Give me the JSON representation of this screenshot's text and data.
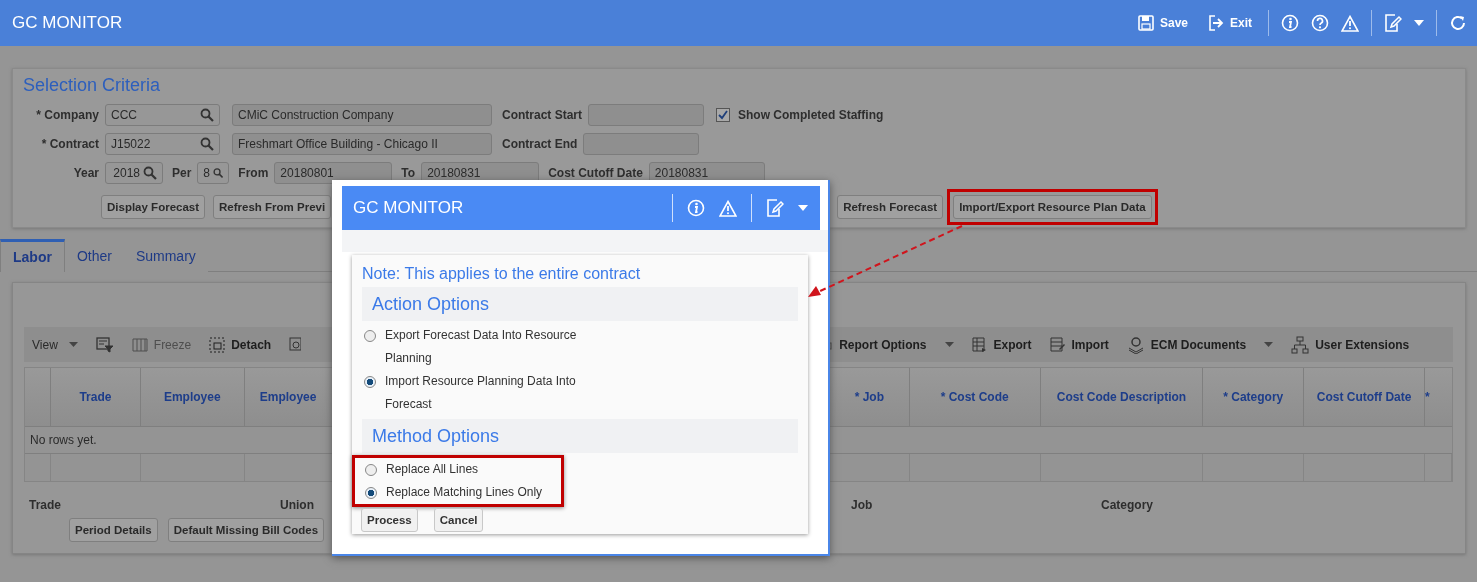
{
  "app_bar": {
    "title": "GC MONITOR",
    "actions": [
      {
        "label": "Save"
      },
      {
        "label": "Exit"
      }
    ]
  },
  "selection_criteria": {
    "title": "Selection Criteria",
    "company": {
      "label": "* Company",
      "value": "CCC",
      "description": "CMiC Construction Company"
    },
    "contract": {
      "label": "* Contract",
      "value": "J15022",
      "description": "Freshmart Office Building - Chicago II"
    },
    "contract_start": {
      "label": "Contract Start"
    },
    "contract_end": {
      "label": "Contract End"
    },
    "show_completed": {
      "label": "Show Completed Staffing",
      "checked": true
    },
    "year": {
      "label": "Year",
      "value": "2018"
    },
    "per": {
      "label": "Per",
      "value": "8"
    },
    "from": {
      "label": "From",
      "value": "20180801"
    },
    "to": {
      "label": "To",
      "value": "20180831"
    },
    "cost_cutoff": {
      "label": "Cost Cutoff Date",
      "value": "20180831"
    },
    "buttons_left": [
      "Display Forecast",
      "Refresh From Previ"
    ],
    "buttons_right": [
      {
        "label": "Refresh Forecast",
        "highlighted": false
      },
      {
        "label": "Import/Export Resource Plan Data",
        "highlighted": true
      }
    ]
  },
  "tabs": [
    {
      "label": "Labor",
      "selected": true
    },
    {
      "label": "Other",
      "selected": false
    },
    {
      "label": "Summary",
      "selected": false
    }
  ],
  "toolbar": {
    "left": [
      {
        "label": "View"
      },
      {
        "label": "Freeze",
        "disabled": true
      },
      {
        "label": "Detach",
        "disabled": false
      }
    ],
    "right": [
      {
        "label": "Report Options"
      },
      {
        "label": "Export"
      },
      {
        "label": "Import"
      },
      {
        "label": "ECM Documents"
      },
      {
        "label": "User Extensions"
      }
    ]
  },
  "table": {
    "columns_left": [
      "Trade",
      "Employee",
      "Employee"
    ],
    "columns_right": [
      "* Job",
      "* Cost Code",
      "Cost Code Description",
      "* Category",
      "Cost Cutoff Date",
      "*"
    ],
    "empty_message": "No rows yet."
  },
  "footer": {
    "labels_left": [
      "Trade",
      "Union"
    ],
    "labels_right": [
      "Job",
      "Category"
    ],
    "buttons": [
      "Period Details",
      "Default Missing Bill Codes"
    ]
  },
  "dialog": {
    "title": "GC MONITOR",
    "note": "Note: This applies to the entire contract",
    "sections": [
      {
        "title": "Action Options",
        "highlighted": false,
        "options": [
          {
            "label": "Export Forecast Data Into Resource Planning",
            "selected": false
          },
          {
            "label": "Import Resource Planning Data Into Forecast",
            "selected": true
          }
        ]
      },
      {
        "title": "Method Options",
        "highlighted": true,
        "options": [
          {
            "label": "Replace All Lines",
            "selected": false
          },
          {
            "label": "Replace Matching Lines Only",
            "selected": true
          }
        ]
      }
    ],
    "buttons": [
      "Process",
      "Cancel"
    ]
  }
}
